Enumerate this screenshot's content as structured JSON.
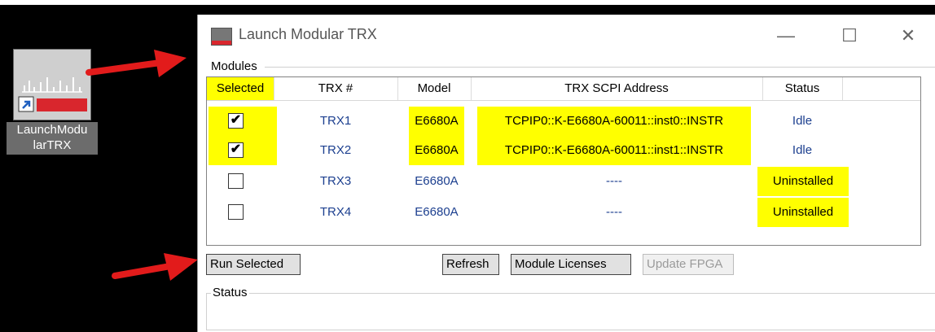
{
  "shortcut": {
    "label_line1": "LaunchModu",
    "label_line2": "larTRX"
  },
  "window": {
    "title": "Launch Modular TRX",
    "minimize_glyph": "—",
    "maximize_glyph": "☐",
    "close_glyph": "✕"
  },
  "modules_group": {
    "label": "Modules"
  },
  "table": {
    "headers": [
      "Selected",
      "TRX #",
      "Model",
      "TRX SCPI Address",
      "Status"
    ],
    "rows": [
      {
        "checked": "✔",
        "trx": "TRX1",
        "model": "E6680A",
        "address": "TCPIP0::K-E6680A-60011::inst0::INSTR",
        "status": "Idle"
      },
      {
        "checked": "✔",
        "trx": "TRX2",
        "model": "E6680A",
        "address": "TCPIP0::K-E6680A-60011::inst1::INSTR",
        "status": "Idle"
      },
      {
        "checked": "",
        "trx": "TRX3",
        "model": "E6680A",
        "address": "----",
        "status": "Uninstalled"
      },
      {
        "checked": "",
        "trx": "TRX4",
        "model": "E6680A",
        "address": "----",
        "status": "Uninstalled"
      }
    ]
  },
  "buttons": {
    "run_selected": "Run Selected",
    "refresh": "Refresh",
    "module_licenses": "Module Licenses",
    "update_fpga": "Update FPGA"
  },
  "status_group": {
    "label": "Status"
  },
  "colors": {
    "highlight": "#ffff00",
    "arrow": "#e21b1b",
    "link_text": "#1c3f8f"
  }
}
